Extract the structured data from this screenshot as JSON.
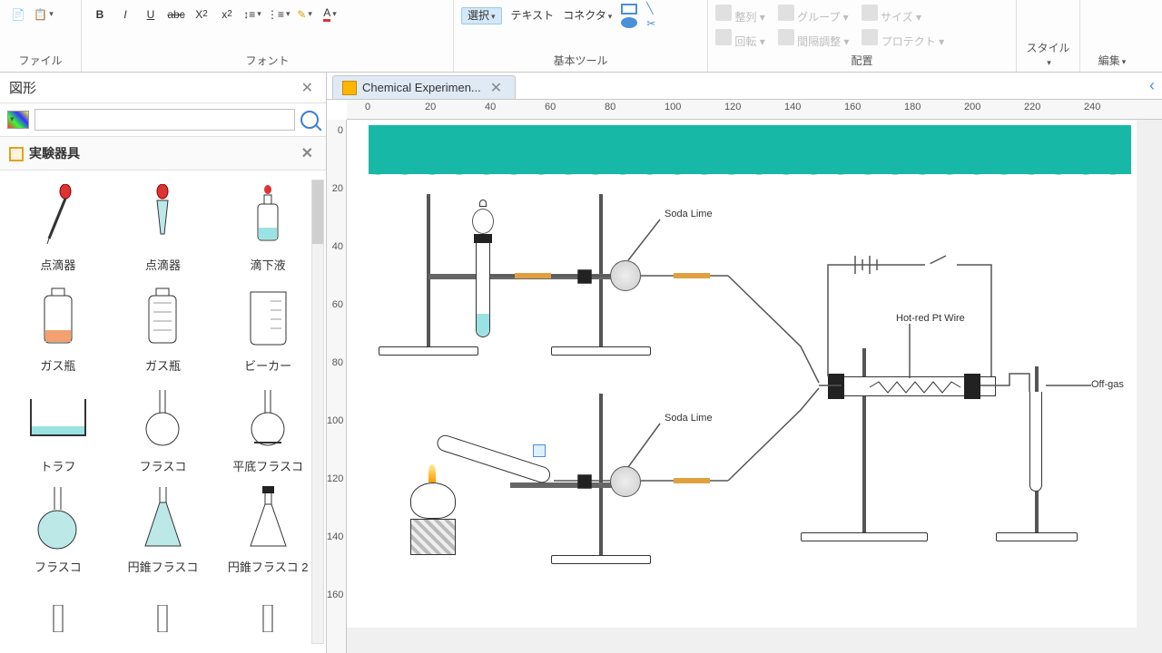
{
  "ribbon": {
    "file": {
      "label": "ファイル"
    },
    "font": {
      "label": "フォント"
    },
    "tools": {
      "label": "基本ツール",
      "select": "選択",
      "text": "テキスト",
      "connector": "コネクタ"
    },
    "arrange": {
      "label": "配置",
      "align": "整列",
      "rotate": "回転",
      "group": "グループ",
      "spacing": "間隔調整",
      "size": "サイズ",
      "lock": "プロテクト"
    },
    "style": {
      "label": "スタイル"
    },
    "edit": {
      "label": "編集"
    }
  },
  "shapes_panel": {
    "title": "図形",
    "search_placeholder": "",
    "library": "実験器具",
    "items": [
      [
        "点滴器",
        "点滴器",
        "滴下液"
      ],
      [
        "ガス瓶",
        "ガス瓶",
        "ビーカー"
      ],
      [
        "トラフ",
        "フラスコ",
        "平底フラスコ"
      ],
      [
        "フラスコ",
        "円錐フラスコ",
        "円錐フラスコ 2"
      ]
    ]
  },
  "tab": {
    "name": "Chemical Experimen..."
  },
  "ruler_h": [
    "0",
    "20",
    "40",
    "60",
    "80",
    "100",
    "120",
    "140",
    "160",
    "180",
    "200",
    "220",
    "240"
  ],
  "ruler_v": [
    "0",
    "20",
    "40",
    "60",
    "80",
    "100",
    "120",
    "140",
    "160"
  ],
  "diagram": {
    "soda_lime_1": "Soda Lime",
    "soda_lime_2": "Soda Lime",
    "wire": "Hot-red Pt Wire",
    "offgas": "Off-gas"
  }
}
